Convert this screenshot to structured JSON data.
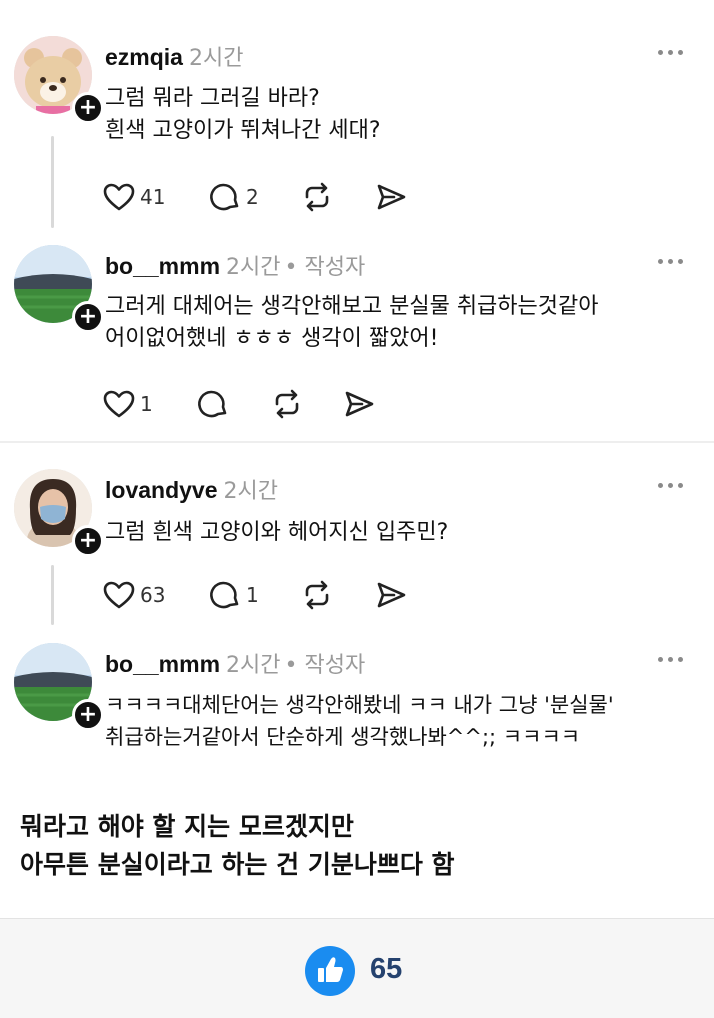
{
  "posts": [
    {
      "username": "ezmqia",
      "time": "2시간",
      "author_tag": "",
      "text": "그럼 뭐라 그러길 바라?\n흰색 고양이가 뛰쳐나간 세대?",
      "likes": "41",
      "replies": "2"
    },
    {
      "username": "bo__mmm",
      "time": "2시간",
      "author_tag": "• 작성자",
      "text": "그러게 대체어는 생각안해보고 분실물 취급하는것같아\n어이없어했네 ㅎㅎㅎ 생각이 짧았어!",
      "likes": "1",
      "replies": ""
    },
    {
      "username": "lovandyve",
      "time": "2시간",
      "author_tag": "",
      "text": "그럼  흰색 고양이와 헤어지신 입주민?",
      "likes": "63",
      "replies": "1"
    },
    {
      "username": "bo__mmm",
      "time": "2시간",
      "author_tag": "• 작성자",
      "text": "ㅋㅋㅋㅋ대체단어는 생각안해봤네 ㅋㅋ 내가 그냥 '분실물'\n취급하는거같아서 단순하게 생각했나봐^^;; ㅋㅋㅋㅋ",
      "likes": "",
      "replies": ""
    }
  ],
  "caption": "뭐라고 해야 할 지는 모르겠지만\n아무튼 분실이라고 하는 건 기분나쁘다 함",
  "footer": {
    "like_count": "65"
  },
  "colors": {
    "accent": "#1a8cf0",
    "count_text": "#25426e",
    "muted": "#9a9a9a"
  }
}
